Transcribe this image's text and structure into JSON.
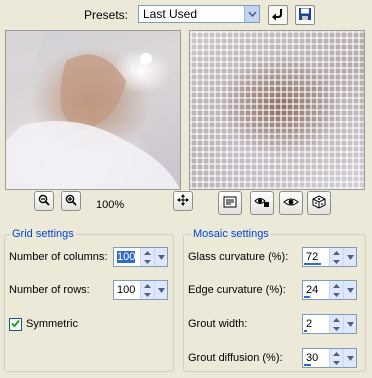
{
  "presets": {
    "label": "Presets:",
    "value": "Last Used"
  },
  "toolbar": {
    "zoom_level": "100%"
  },
  "grid_settings": {
    "title": "Grid settings",
    "columns_label": "Number of columns:",
    "columns_value": "100",
    "rows_label": "Number of rows:",
    "rows_value": "100",
    "symmetric_label": "Symmetric",
    "symmetric_checked": true
  },
  "mosaic_settings": {
    "title": "Mosaic settings",
    "glass_label": "Glass curvature (%):",
    "glass_value": "72",
    "edge_label": "Edge curvature (%):",
    "edge_value": "24",
    "grout_width_label": "Grout width:",
    "grout_width_value": "2",
    "grout_diffusion_label": "Grout diffusion (%):",
    "grout_diffusion_value": "30"
  },
  "colors": {
    "accent": "#0046d5",
    "selection": "#316ac5",
    "background": "#ece9d8"
  }
}
